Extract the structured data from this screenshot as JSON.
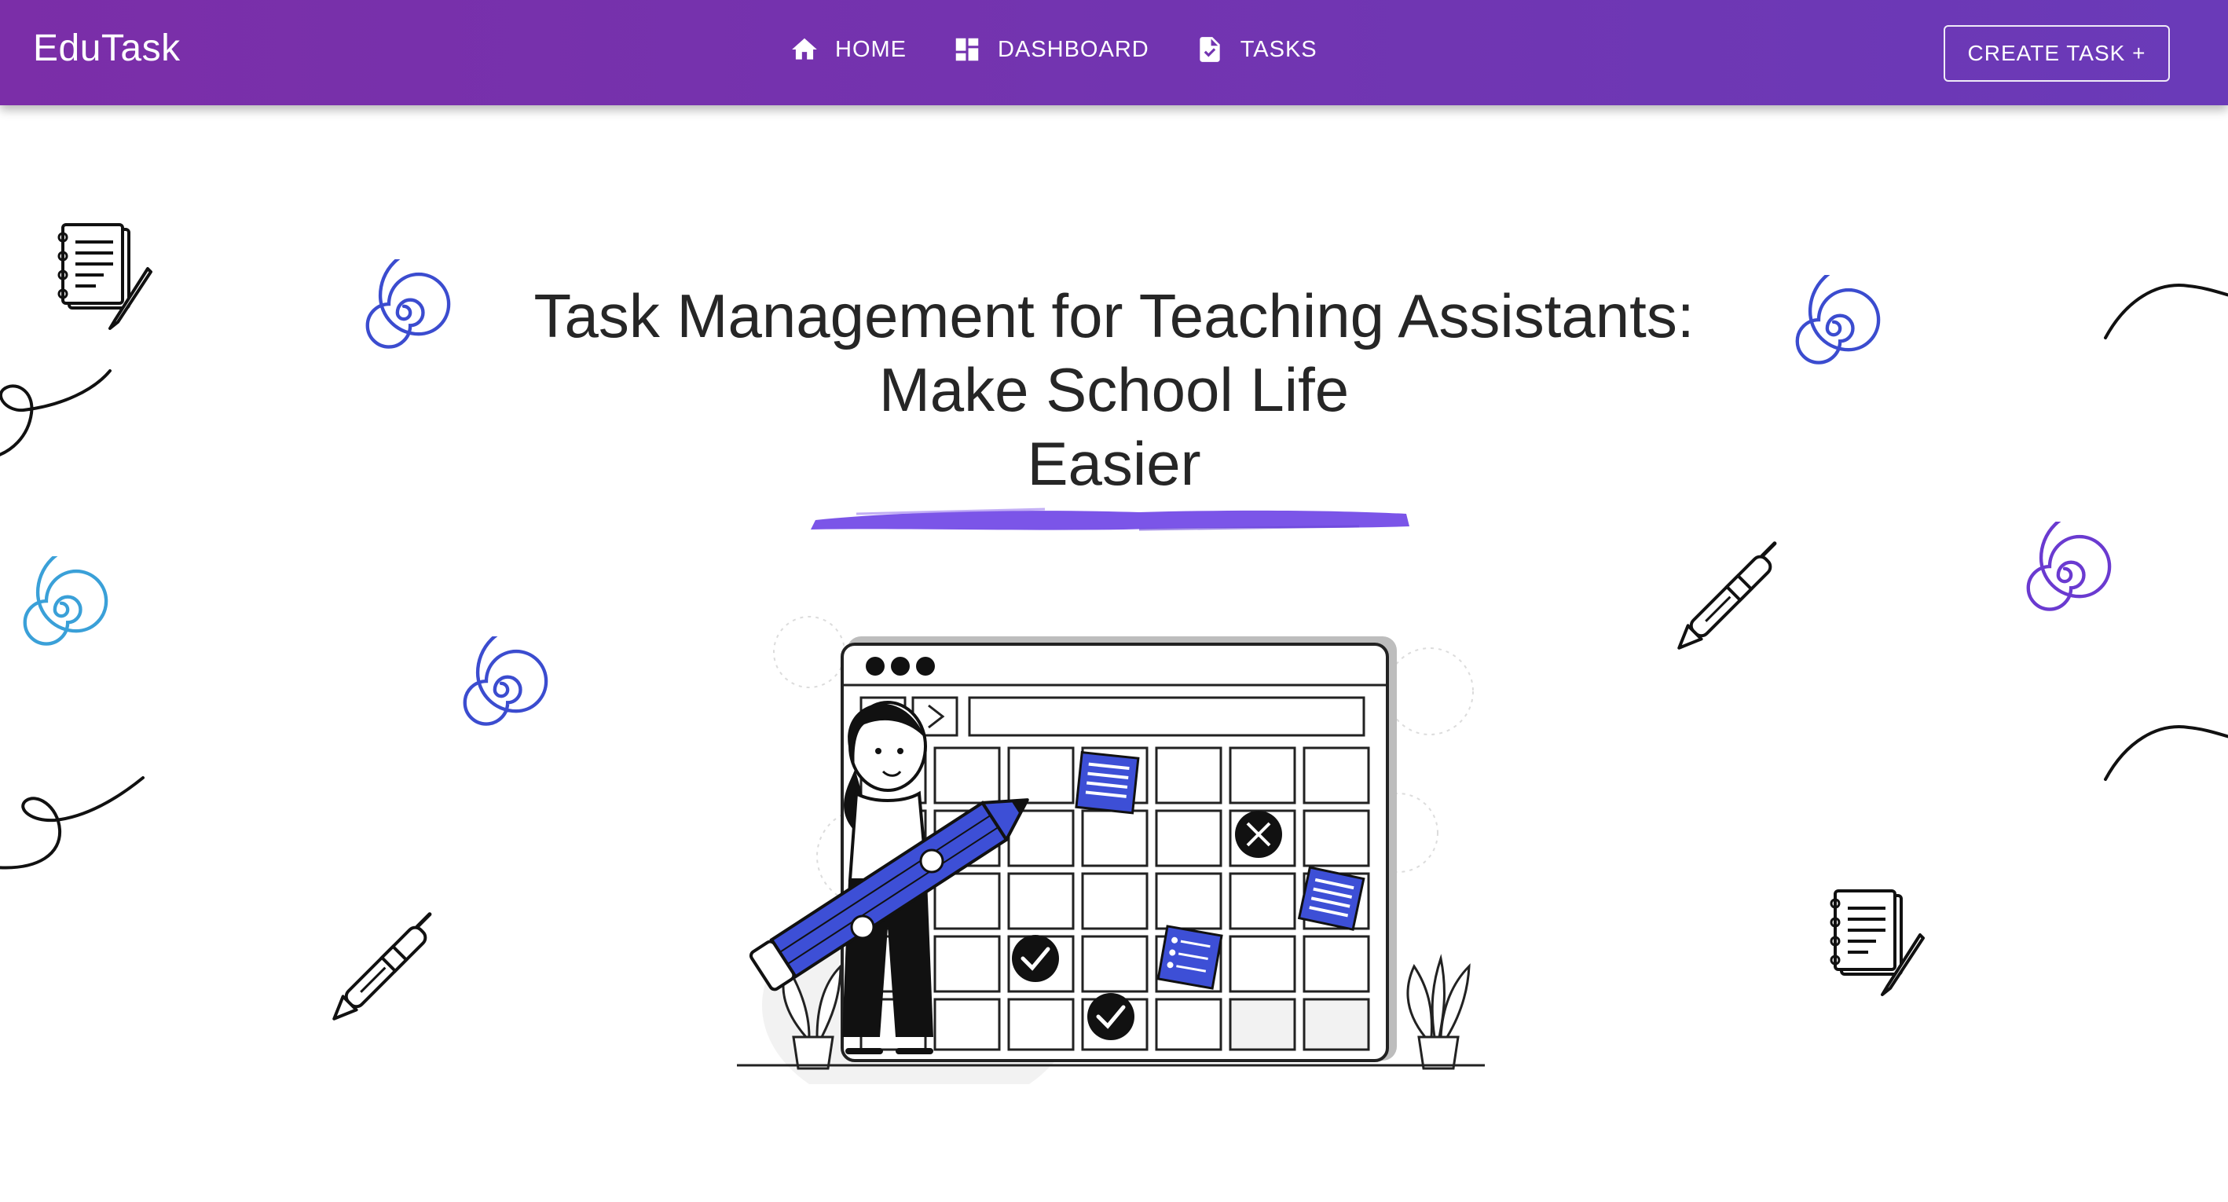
{
  "app": {
    "brand": "EduTask"
  },
  "nav": {
    "items": [
      {
        "label": "HOME",
        "icon": "home-icon"
      },
      {
        "label": "DASHBOARD",
        "icon": "dashboard-icon"
      },
      {
        "label": "TASKS",
        "icon": "task-file-icon"
      }
    ],
    "create_label": "CREATE TASK +"
  },
  "hero": {
    "title_line1": "Task Management for Teaching Assistants:",
    "title_line2": "Make School Life",
    "title_line3": "Easier"
  },
  "colors": {
    "nav_from": "#7b2ea8",
    "nav_to": "#6a3ab8",
    "accent_blue": "#3d4fd6",
    "accent_purple": "#7b55e8",
    "spiral_blue": "#3b4ccf",
    "spiral_light": "#3aa0d8",
    "spiral_purple": "#6a3ad0"
  }
}
